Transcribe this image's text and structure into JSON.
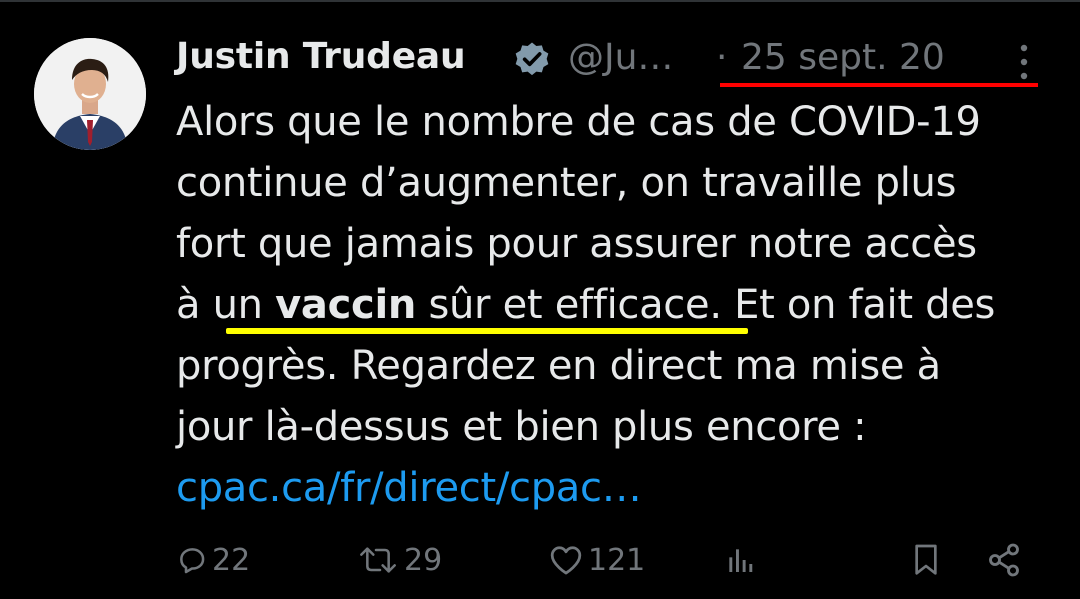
{
  "author": {
    "name": "Justin Trudeau",
    "handle": "@Ju…",
    "separator": "·",
    "date": "25 sept. 20",
    "verified_icon": "verified-badge-icon",
    "more_icon": "more-vertical-icon"
  },
  "tweet": {
    "line1": "Alors que le nombre de cas de COVID-19",
    "line2": "continue d’augmenter, on travaille plus",
    "line3": "fort que jamais pour assurer notre accès",
    "line4_pre": "à un ",
    "line4_bold": "vaccin",
    "line4_post": " sûr et efficace. Et on fait des",
    "line5": "progrès. Regardez en direct ma mise à",
    "line6": "jour là-dessus et bien plus encore :",
    "link": "cpac.ca/fr/direct/cpac…"
  },
  "actions": {
    "replies": "22",
    "retweets": "29",
    "likes": "121"
  },
  "colors": {
    "background": "#000000",
    "text": "#e7e9ea",
    "muted": "#71767b",
    "link": "#1d9bf0",
    "annotation_red": "#ff0000",
    "annotation_yellow": "#ffff00"
  }
}
